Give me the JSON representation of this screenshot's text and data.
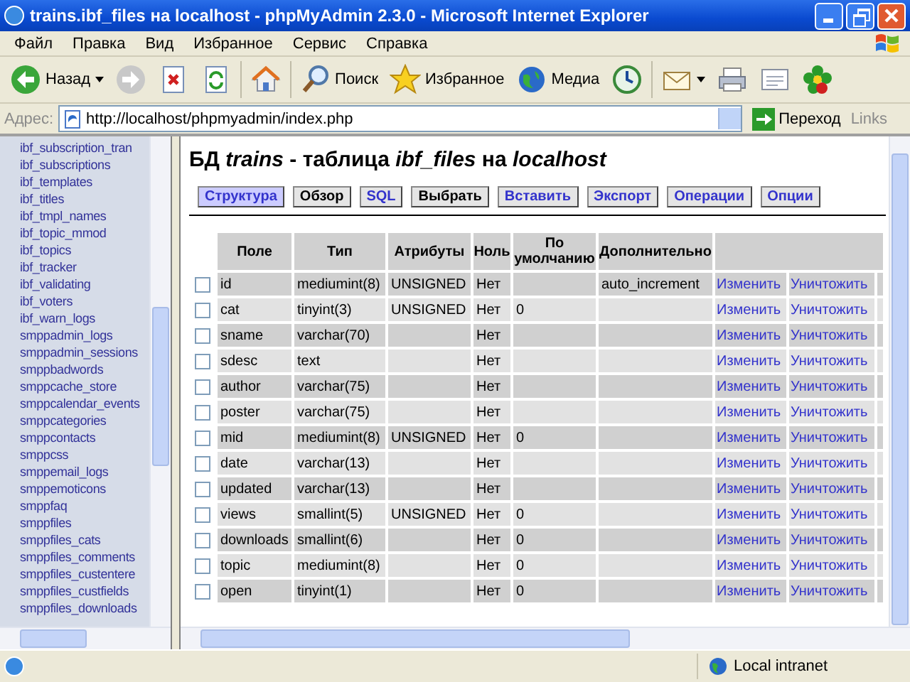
{
  "window": {
    "title": "trains.ibf_files на localhost - phpMyAdmin 2.3.0 - Microsoft Internet Explorer"
  },
  "menu": [
    "Файл",
    "Правка",
    "Вид",
    "Избранное",
    "Сервис",
    "Справка"
  ],
  "toolbar": [
    {
      "kind": "back",
      "label": "Назад"
    },
    {
      "kind": "forward"
    },
    {
      "kind": "stop"
    },
    {
      "kind": "refresh"
    },
    {
      "kind": "home"
    },
    {
      "kind": "search",
      "label": "Поиск"
    },
    {
      "kind": "favorites",
      "label": "Избранное"
    },
    {
      "kind": "media",
      "label": "Медиа"
    },
    {
      "kind": "history"
    },
    {
      "kind": "mail"
    },
    {
      "kind": "print"
    },
    {
      "kind": "edit"
    },
    {
      "kind": "flower"
    }
  ],
  "address": {
    "label": "Адрес:",
    "value": "http://localhost/phpmyadmin/index.php",
    "go": "Переход",
    "links": "Links"
  },
  "sidebar": {
    "items": [
      "ibf_subscription_tran",
      "ibf_subscriptions",
      "ibf_templates",
      "ibf_titles",
      "ibf_tmpl_names",
      "ibf_topic_mmod",
      "ibf_topics",
      "ibf_tracker",
      "ibf_validating",
      "ibf_voters",
      "ibf_warn_logs",
      "smppadmin_logs",
      "smppadmin_sessions",
      "smppbadwords",
      "smppcache_store",
      "smppcalendar_events",
      "smppcategories",
      "smppcontacts",
      "smppcss",
      "smppemail_logs",
      "smppemoticons",
      "smppfaq",
      "smppfiles",
      "smppfiles_cats",
      "smppfiles_comments",
      "smppfiles_custentere",
      "smppfiles_custfields",
      "smppfiles_downloads"
    ]
  },
  "heading": "БД *trains* - таблица *ibf_files* на *localhost*",
  "tabs": [
    {
      "label": "Структура",
      "selected": true,
      "disabled": false
    },
    {
      "label": "Обзор",
      "selected": false,
      "disabled": true
    },
    {
      "label": "SQL",
      "selected": false,
      "disabled": false
    },
    {
      "label": "Выбрать",
      "selected": false,
      "disabled": true
    },
    {
      "label": "Вставить",
      "selected": false,
      "disabled": false
    },
    {
      "label": "Экспорт",
      "selected": false,
      "disabled": false
    },
    {
      "label": "Операции",
      "selected": false,
      "disabled": false
    },
    {
      "label": "Опции",
      "selected": false,
      "disabled": false
    }
  ],
  "table": {
    "columns": [
      "Поле",
      "Тип",
      "Атрибуты",
      "Ноль",
      "По умолчанию",
      "Дополнительно"
    ],
    "rows": [
      {
        "checked": false,
        "field": "id",
        "type": "mediumint(8)",
        "attributes": "UNSIGNED",
        "null": "Нет",
        "extra": "auto_increment",
        "actions": [
          "Изменить",
          "Уничтожить"
        ]
      },
      {
        "checked": false,
        "field": "cat",
        "type": "tinyint(3)",
        "attributes": "UNSIGNED",
        "null": "Нет",
        "default": "0",
        "actions": [
          "Изменить",
          "Уничтожить"
        ]
      },
      {
        "checked": false,
        "field": "sname",
        "type": "varchar(70)",
        "null": "Нет",
        "actions": [
          "Изменить",
          "Уничтожить"
        ]
      },
      {
        "checked": false,
        "field": "sdesc",
        "type": "text",
        "null": "Нет",
        "actions": [
          "Изменить",
          "Уничтожить"
        ]
      },
      {
        "checked": false,
        "field": "author",
        "type": "varchar(75)",
        "null": "Нет",
        "actions": [
          "Изменить",
          "Уничтожить"
        ]
      },
      {
        "checked": false,
        "field": "poster",
        "type": "varchar(75)",
        "null": "Нет",
        "actions": [
          "Изменить",
          "Уничтожить"
        ]
      },
      {
        "checked": false,
        "field": "mid",
        "type": "mediumint(8)",
        "attributes": "UNSIGNED",
        "null": "Нет",
        "default": "0",
        "actions": [
          "Изменить",
          "Уничтожить"
        ]
      },
      {
        "checked": false,
        "field": "date",
        "type": "varchar(13)",
        "null": "Нет",
        "actions": [
          "Изменить",
          "Уничтожить"
        ]
      },
      {
        "checked": false,
        "field": "updated",
        "type": "varchar(13)",
        "null": "Нет",
        "actions": [
          "Изменить",
          "Уничтожить"
        ]
      },
      {
        "checked": false,
        "field": "views",
        "type": "smallint(5)",
        "attributes": "UNSIGNED",
        "null": "Нет",
        "default": "0",
        "actions": [
          "Изменить",
          "Уничтожить"
        ]
      },
      {
        "checked": false,
        "field": "downloads",
        "type": "smallint(6)",
        "null": "Нет",
        "default": "0",
        "actions": [
          "Изменить",
          "Уничтожить"
        ]
      },
      {
        "checked": false,
        "field": "topic",
        "type": "mediumint(8)",
        "null": "Нет",
        "default": "0",
        "actions": [
          "Изменить",
          "Уничтожить"
        ]
      },
      {
        "checked": false,
        "field": "open",
        "type": "tinyint(1)",
        "null": "Нет",
        "default": "0",
        "actions": [
          "Изменить",
          "Уничтожить"
        ]
      }
    ]
  },
  "status_bar": {
    "zone": "Local intranet"
  }
}
